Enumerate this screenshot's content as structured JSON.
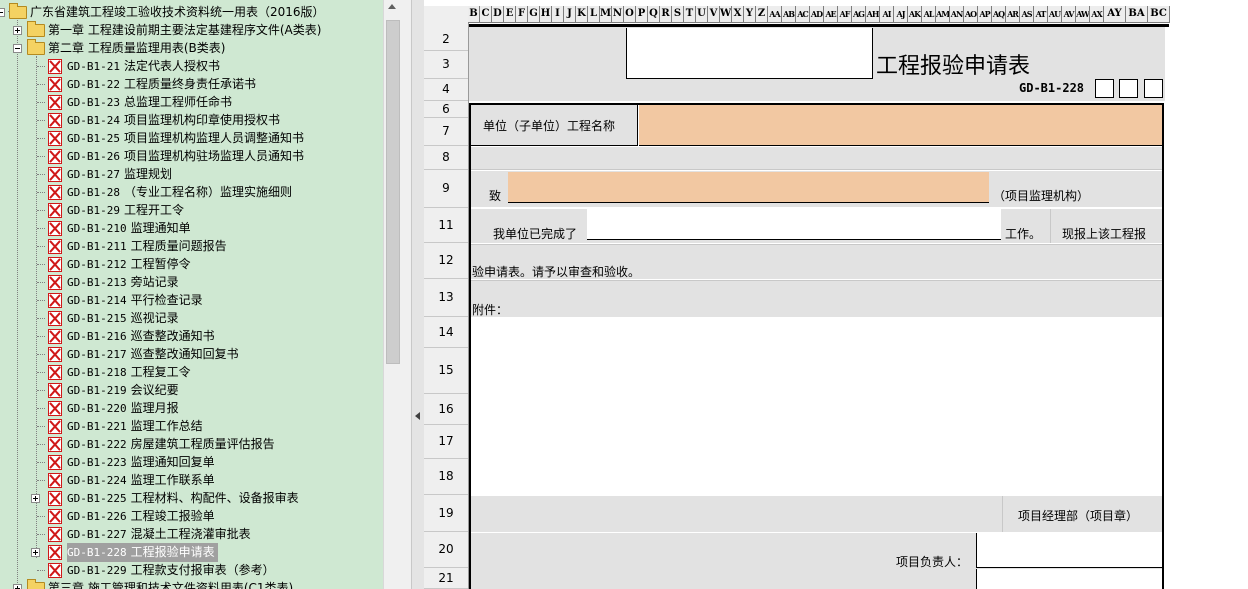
{
  "tree": {
    "root_label": "广东省建筑工程竣工验收技术资料统一用表（2016版）",
    "chapter1_label": "第一章 工程建设前期主要法定基建程序文件(A类表)",
    "chapter2_label": "第二章 工程质量监理用表(B类表)",
    "chapter3_label": "第三章 施工管理和技术文件资料用表(C1类表)",
    "items": [
      {
        "code": "GD-B1-21",
        "title": "法定代表人授权书"
      },
      {
        "code": "GD-B1-22",
        "title": "工程质量终身责任承诺书"
      },
      {
        "code": "GD-B1-23",
        "title": "总监理工程师任命书"
      },
      {
        "code": "GD-B1-24",
        "title": "项目监理机构印章使用授权书"
      },
      {
        "code": "GD-B1-25",
        "title": "项目监理机构监理人员调整通知书"
      },
      {
        "code": "GD-B1-26",
        "title": "项目监理机构驻场监理人员通知书"
      },
      {
        "code": "GD-B1-27",
        "title": "监理规划"
      },
      {
        "code": "GD-B1-28",
        "title": "（专业工程名称）监理实施细则"
      },
      {
        "code": "GD-B1-29",
        "title": "工程开工令"
      },
      {
        "code": "GD-B1-210",
        "title": "监理通知单"
      },
      {
        "code": "GD-B1-211",
        "title": "工程质量问题报告"
      },
      {
        "code": "GD-B1-212",
        "title": "工程暂停令"
      },
      {
        "code": "GD-B1-213",
        "title": "旁站记录"
      },
      {
        "code": "GD-B1-214",
        "title": "平行检查记录"
      },
      {
        "code": "GD-B1-215",
        "title": "巡视记录"
      },
      {
        "code": "GD-B1-216",
        "title": "巡查整改通知书"
      },
      {
        "code": "GD-B1-217",
        "title": "巡查整改通知回复书"
      },
      {
        "code": "GD-B1-218",
        "title": "工程复工令"
      },
      {
        "code": "GD-B1-219",
        "title": "会议纪要"
      },
      {
        "code": "GD-B1-220",
        "title": "监理月报"
      },
      {
        "code": "GD-B1-221",
        "title": "监理工作总结"
      },
      {
        "code": "GD-B1-222",
        "title": "房屋建筑工程质量评估报告"
      },
      {
        "code": "GD-B1-223",
        "title": "监理通知回复单"
      },
      {
        "code": "GD-B1-224",
        "title": "监理工作联系单"
      },
      {
        "code": "GD-B1-225",
        "title": "工程材料、构配件、设备报审表"
      },
      {
        "code": "GD-B1-226",
        "title": "工程竣工报验单"
      },
      {
        "code": "GD-B1-227",
        "title": "混凝土工程浇灌审批表"
      },
      {
        "code": "GD-B1-228",
        "title": "工程报验申请表"
      },
      {
        "code": "GD-B1-229",
        "title": "工程款支付报审表（参考）"
      }
    ],
    "expandable_codes": [
      "GD-B1-225",
      "GD-B1-228"
    ],
    "selected_code": "GD-B1-228"
  },
  "sheet": {
    "column_letters": [
      "B",
      "C",
      "D",
      "E",
      "F",
      "G",
      "H",
      "I",
      "J",
      "K",
      "L",
      "M",
      "N",
      "O",
      "P",
      "Q",
      "R",
      "S",
      "T",
      "U",
      "V",
      "W",
      "X",
      "Y",
      "Z",
      "AA",
      "AB",
      "AC",
      "AD",
      "AE",
      "AF",
      "AG",
      "AH",
      "AI",
      "AJ",
      "AK",
      "AL",
      "AM",
      "AN",
      "AO",
      "AP",
      "AQ",
      "AR",
      "AS",
      "AT",
      "AU",
      "AV",
      "AW",
      "AX",
      "AY",
      "BA",
      "BC"
    ],
    "row_numbers": [
      "2",
      "3",
      "4",
      "6",
      "7",
      "8",
      "9",
      "11",
      "12",
      "13",
      "14",
      "15",
      "16",
      "17",
      "18",
      "19",
      "20",
      "21"
    ],
    "form": {
      "title": "工程报验申请表",
      "code": "GD-B1-228",
      "unit_name_label": "单位（子单位）工程名称",
      "to_label": "致",
      "supervisor_org_label": "（项目监理机构）",
      "completed_label": "我单位已完成了",
      "work_label": "工作。",
      "report_label": "现报上该工程报",
      "request_text": "验申请表。请予以审查和验收。",
      "attachment_label": "附件：",
      "dept_label": "项目经理部（项目章）",
      "person_label": "项目负责人："
    }
  },
  "colors": {
    "tree_bg": "#cfe8d2",
    "input_fill": "#f2c8a2",
    "grid_gray": "#e2e2e2",
    "selected_bg": "#a0a0a0"
  }
}
